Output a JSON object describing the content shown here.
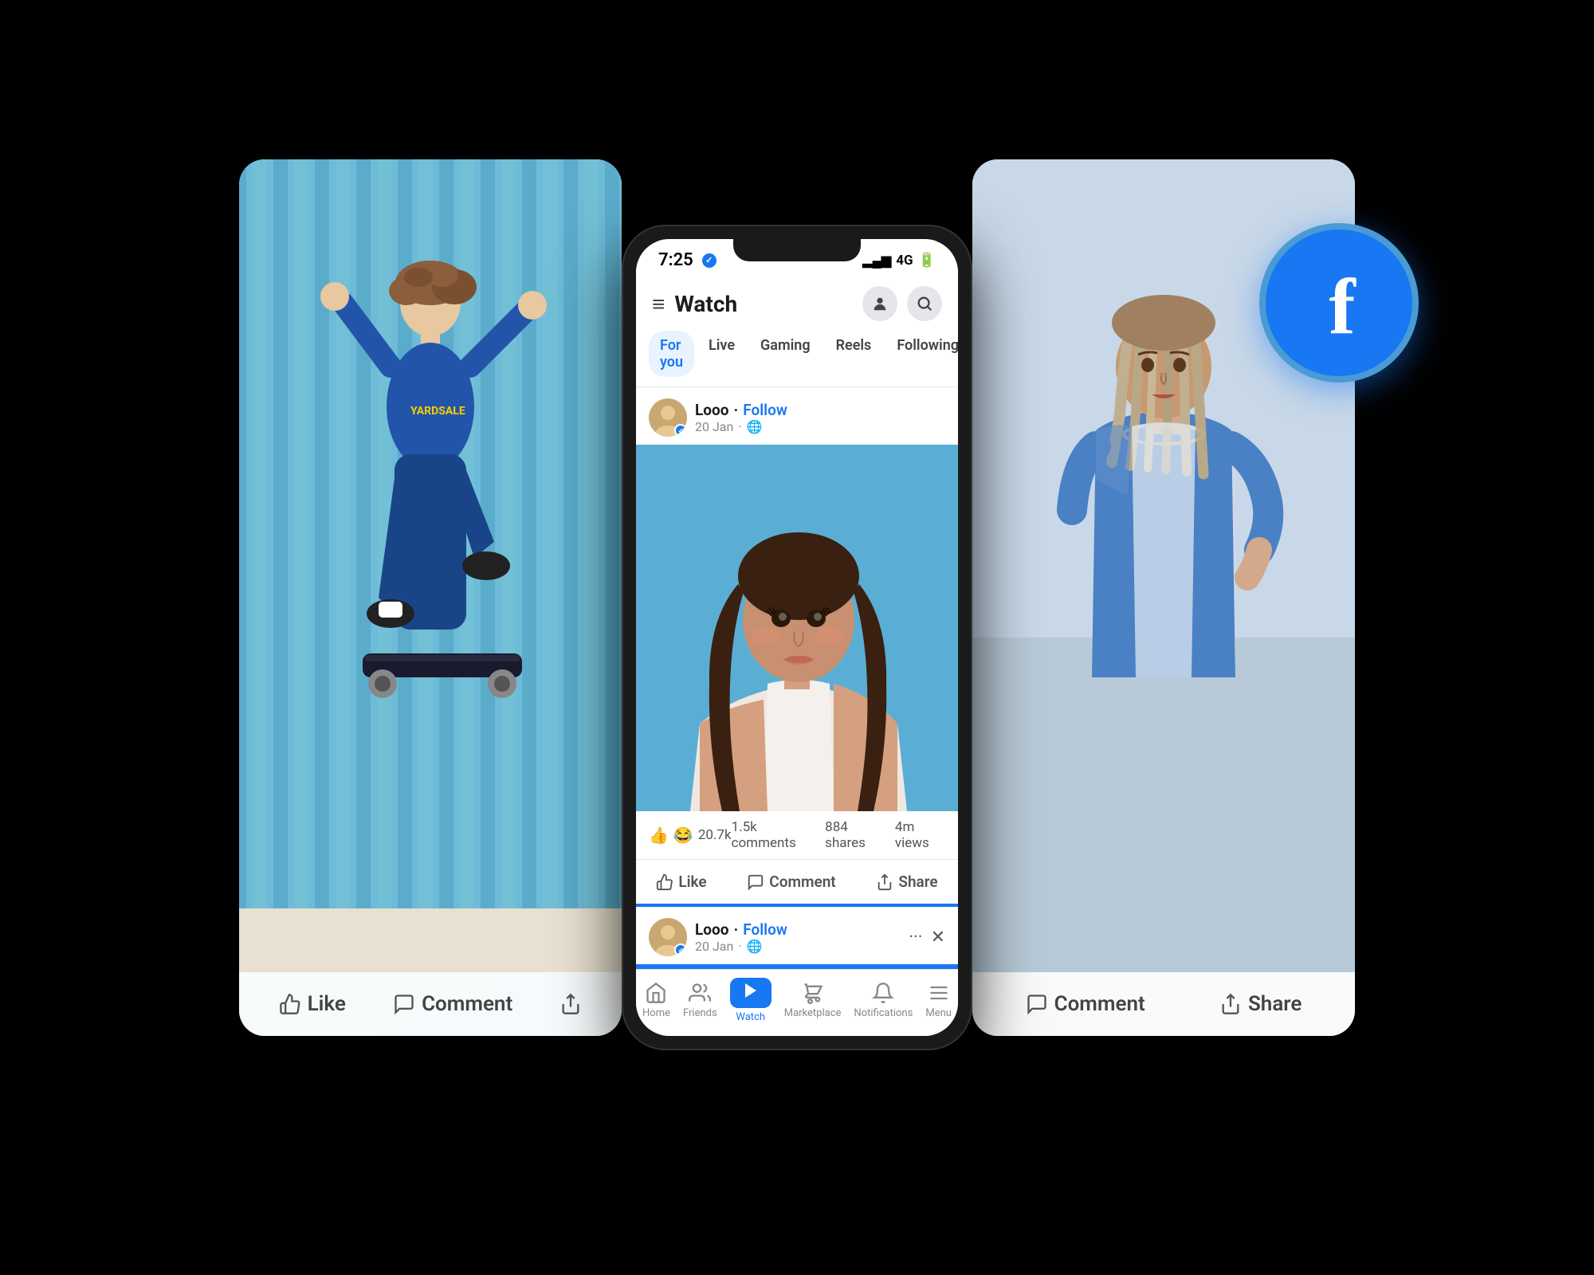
{
  "scene": {
    "background": "#000"
  },
  "status_bar": {
    "time": "7:25",
    "verified_icon": "✓",
    "signal": "▂▄▆",
    "network": "4G",
    "battery": "🔋"
  },
  "header": {
    "menu_icon": "≡",
    "title": "Watch",
    "profile_icon": "👤",
    "search_icon": "🔍"
  },
  "tabs": [
    {
      "label": "For you",
      "active": true
    },
    {
      "label": "Live",
      "active": false
    },
    {
      "label": "Gaming",
      "active": false
    },
    {
      "label": "Reels",
      "active": false
    },
    {
      "label": "Following",
      "active": false
    }
  ],
  "post1": {
    "username": "Looo",
    "dot": "·",
    "follow_label": "Follow",
    "date": "20 Jan",
    "globe_icon": "🌐",
    "reactions_count": "20.7k",
    "comments": "1.5k comments",
    "shares": "884 shares",
    "views": "4m views",
    "like_label": "Like",
    "comment_label": "Comment",
    "share_label": "Share"
  },
  "post2": {
    "username": "Looo",
    "dot": "·",
    "follow_label": "Follow",
    "date": "20 Jan",
    "globe_icon": "🌐",
    "more_icon": "···",
    "close_icon": "✕"
  },
  "bottom_nav": {
    "home_label": "Home",
    "friends_label": "Friends",
    "watch_label": "Watch",
    "marketplace_label": "Marketplace",
    "notifications_label": "Notifications",
    "menu_label": "Menu"
  },
  "left_card": {
    "like_label": "Like",
    "comment_label": "Comment",
    "share_icon": "↗"
  },
  "right_card": {
    "comment_label": "Comment",
    "share_label": "Share"
  },
  "fb_logo": {
    "letter": "f"
  }
}
